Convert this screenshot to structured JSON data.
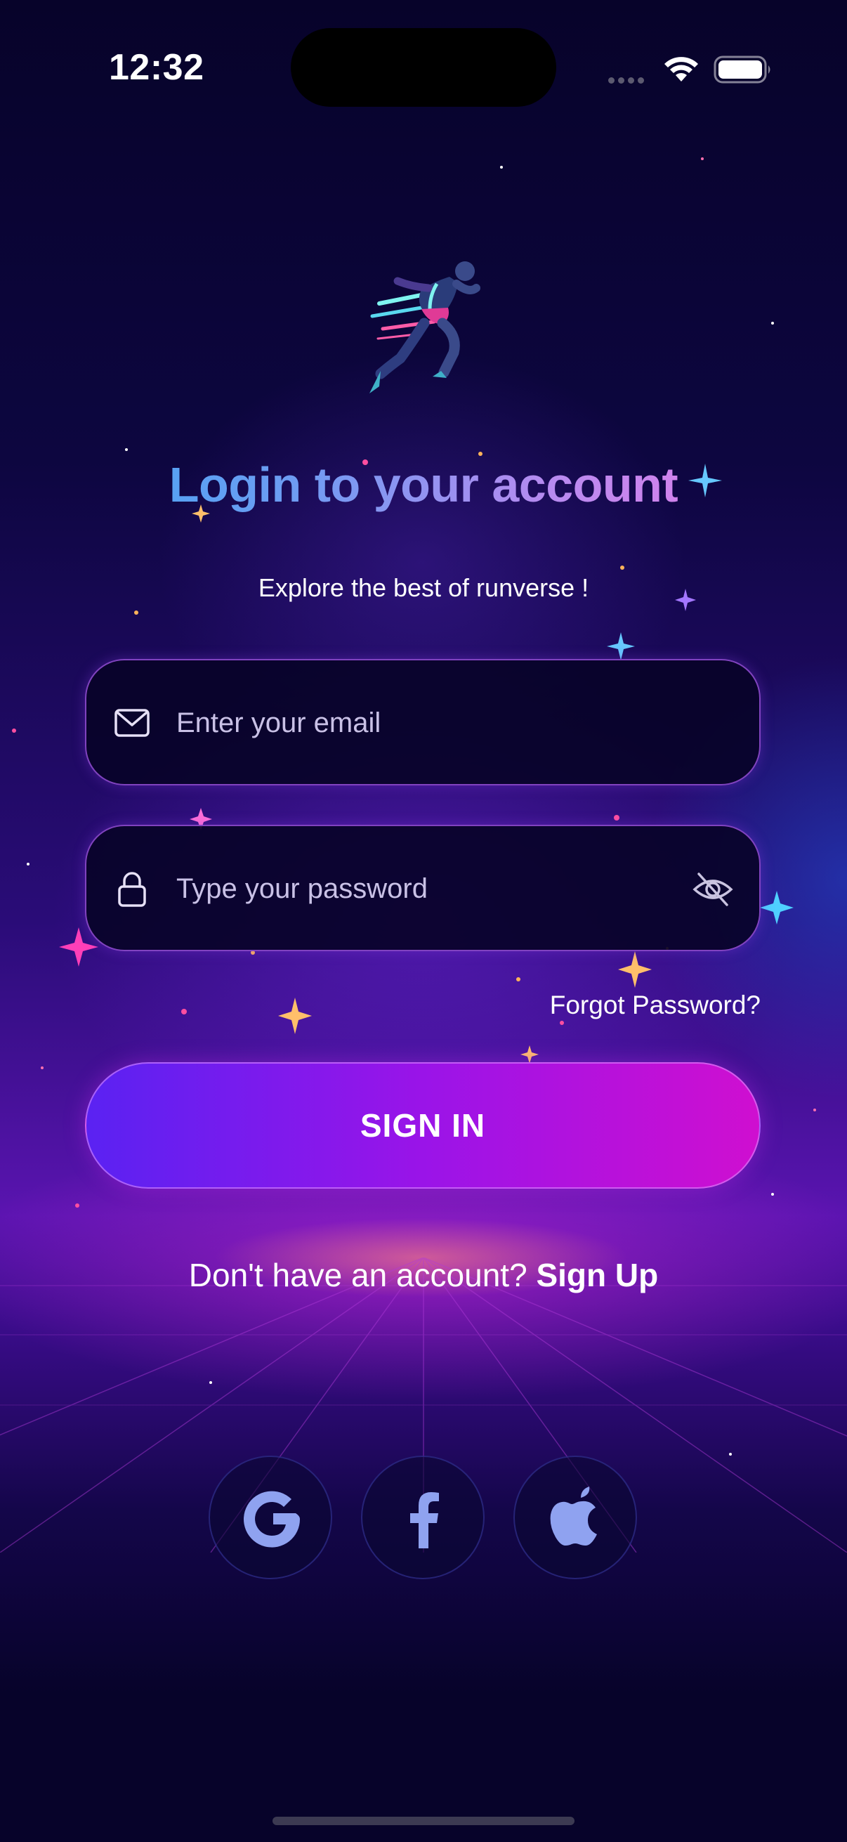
{
  "status_bar": {
    "time": "12:32",
    "icons": [
      "signal-dots-icon",
      "wifi-icon",
      "battery-icon"
    ]
  },
  "hero": {
    "illustration": "running-man-illustration",
    "title": "Login to your account",
    "subtitle": "Explore the best of runverse !"
  },
  "form": {
    "email": {
      "value": "",
      "placeholder": "Enter your email",
      "icon": "mail-icon"
    },
    "password": {
      "value": "",
      "placeholder": "Type your password",
      "icon": "lock-icon",
      "toggle_icon": "eye-off-icon"
    },
    "forgot_label": "Forgot Password?",
    "submit_label": "SIGN IN"
  },
  "signup": {
    "prompt": "Don't have an account?",
    "link": "Sign Up"
  },
  "social": [
    {
      "name": "google",
      "icon": "google-icon"
    },
    {
      "name": "facebook",
      "icon": "facebook-icon"
    },
    {
      "name": "apple",
      "icon": "apple-icon"
    }
  ],
  "colors": {
    "background": "#07032a",
    "accent_start": "#5a22f2",
    "accent_end": "#cf0fd0",
    "title_gradient": [
      "#3aa8f5",
      "#f07ae8"
    ],
    "social_icon": "#8fa2f0"
  }
}
